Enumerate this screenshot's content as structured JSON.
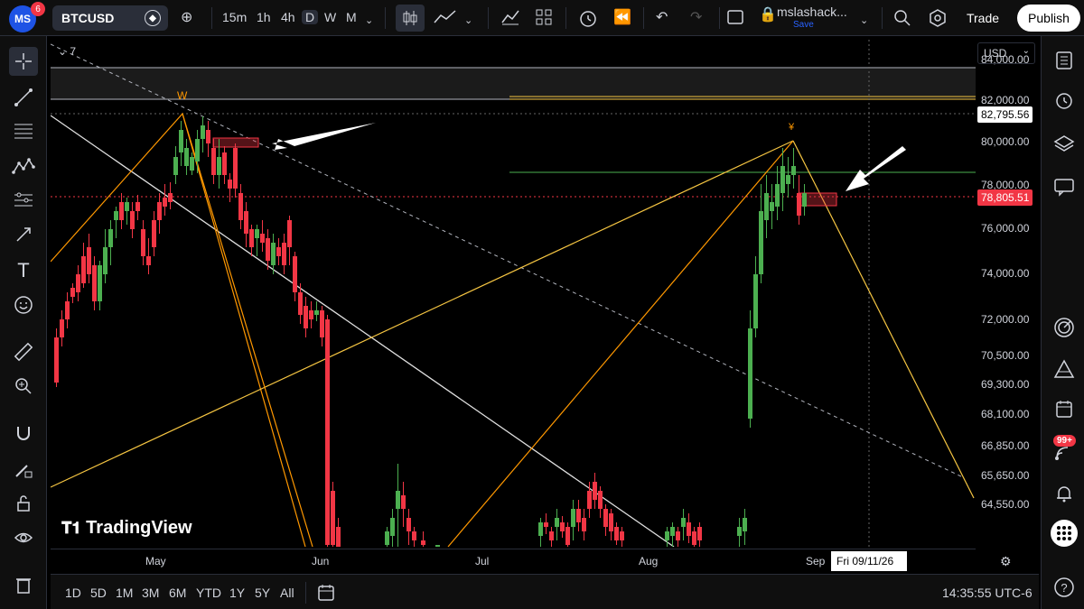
{
  "app": {
    "logo_text": "MS",
    "notification_count": "6"
  },
  "toolbar": {
    "symbol": "BTCUSD",
    "intervals": [
      "15m",
      "1h",
      "4h",
      "D",
      "W",
      "M"
    ],
    "active_interval": "D",
    "layout_name": "mslashack...",
    "layout_save": "Save",
    "trade_label": "Trade",
    "publish_label": "Publish"
  },
  "chart": {
    "collapse_count": "7",
    "currency": "USD",
    "price_labels": [
      "84,000.00",
      "82,000.00",
      "80,000.00",
      "78,000.00",
      "76,000.00",
      "74,000.00",
      "72,000.00",
      "70,500.00",
      "69,300.00",
      "68,100.00",
      "66,850.00",
      "65,650.00",
      "64,550.00"
    ],
    "marker_price": "82,795.56",
    "current_price": "78,805.51",
    "current_price_color": "#f23645",
    "time_labels": [
      "May",
      "Jun",
      "Jul",
      "Aug",
      "Sep"
    ],
    "cursor_date": "Fri 09/11/26",
    "pattern_label_w": "W",
    "watermark": "TradingView",
    "up_color": "#4caf50",
    "down_color": "#f23645"
  },
  "bottom": {
    "ranges": [
      "1D",
      "5D",
      "1M",
      "3M",
      "6M",
      "YTD",
      "1Y",
      "5Y",
      "All"
    ],
    "clock": "14:35:55 UTC-6"
  },
  "sidebar_right": {
    "badge": "99+"
  }
}
